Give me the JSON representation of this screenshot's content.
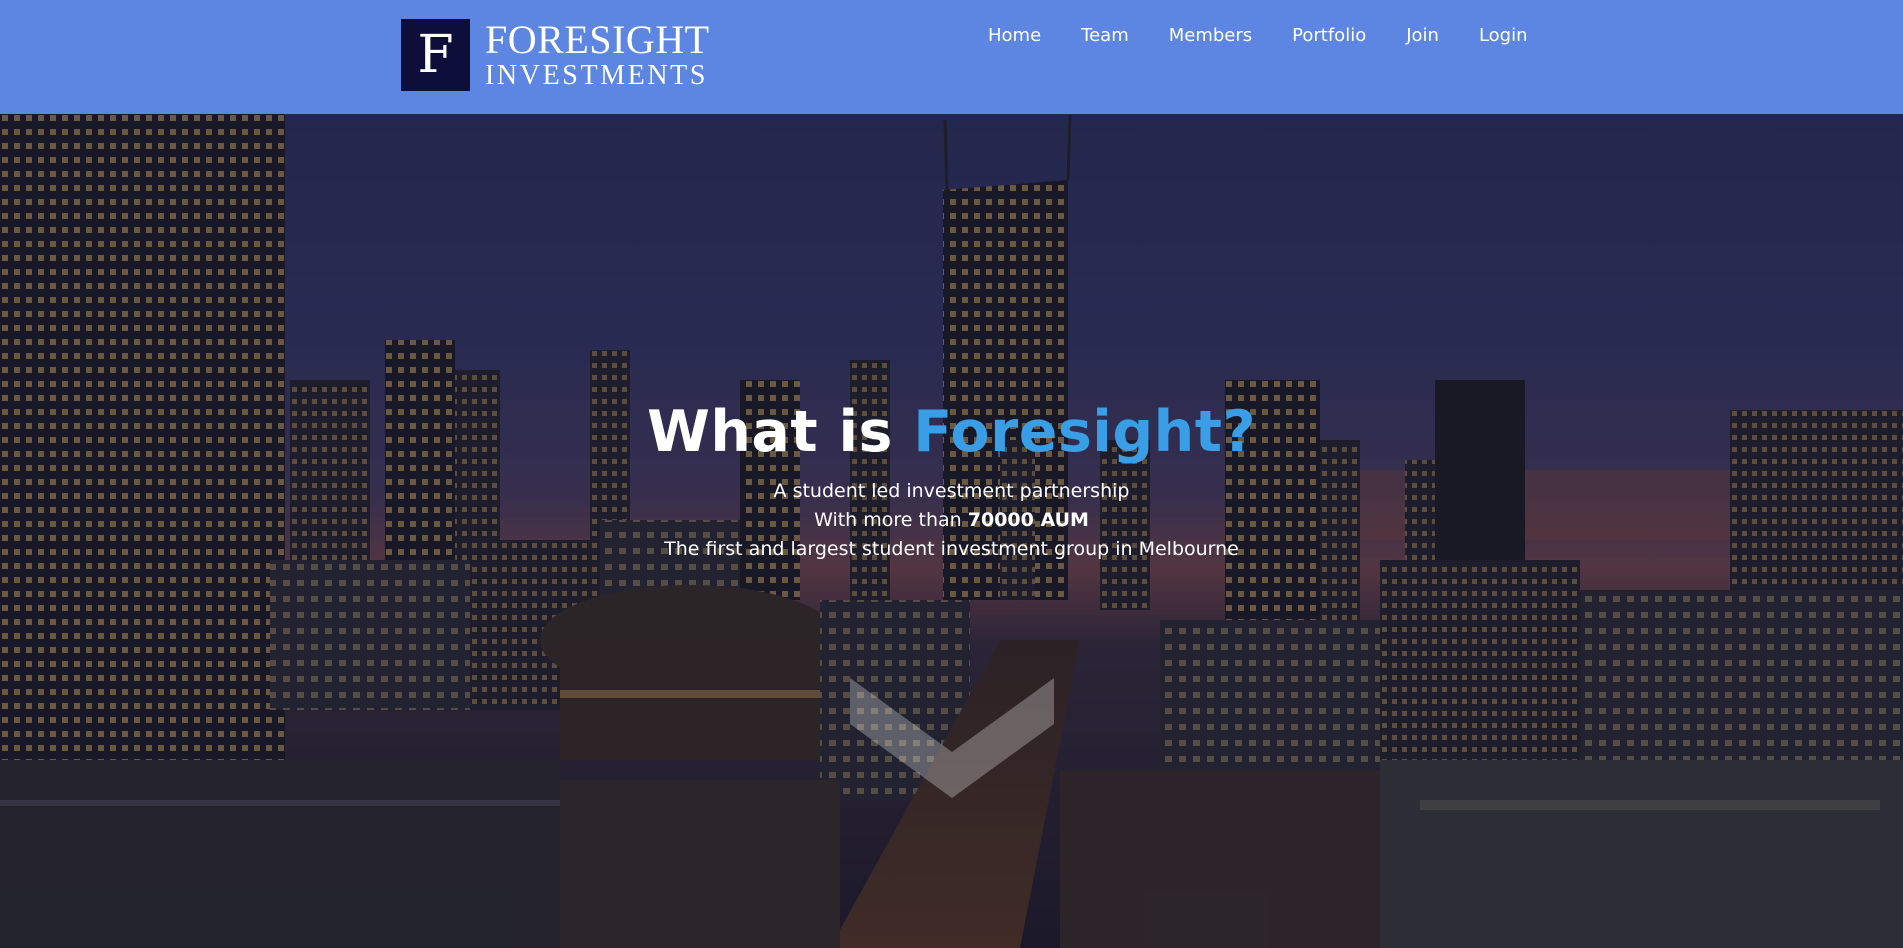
{
  "brand": {
    "mark": "F",
    "line1": "FORESIGHT",
    "line2": "INVESTMENTS",
    "mark_color": "#0d0f3a"
  },
  "nav": {
    "background": "#5f89e8",
    "items": [
      {
        "label": "Home"
      },
      {
        "label": "Team"
      },
      {
        "label": "Members"
      },
      {
        "label": "Portfolio"
      },
      {
        "label": "Join"
      },
      {
        "label": "Login"
      }
    ]
  },
  "hero": {
    "title_prefix": "What is ",
    "title_accent": "Foresight?",
    "accent_color": "#3a9ee6",
    "line1": "A student led investment partnership",
    "line2_prefix": "With more than ",
    "line2_bold": "70000 AUM",
    "line3": "The first and largest student investment group in Melbourne",
    "scroll_icon": "chevron-down-icon"
  }
}
